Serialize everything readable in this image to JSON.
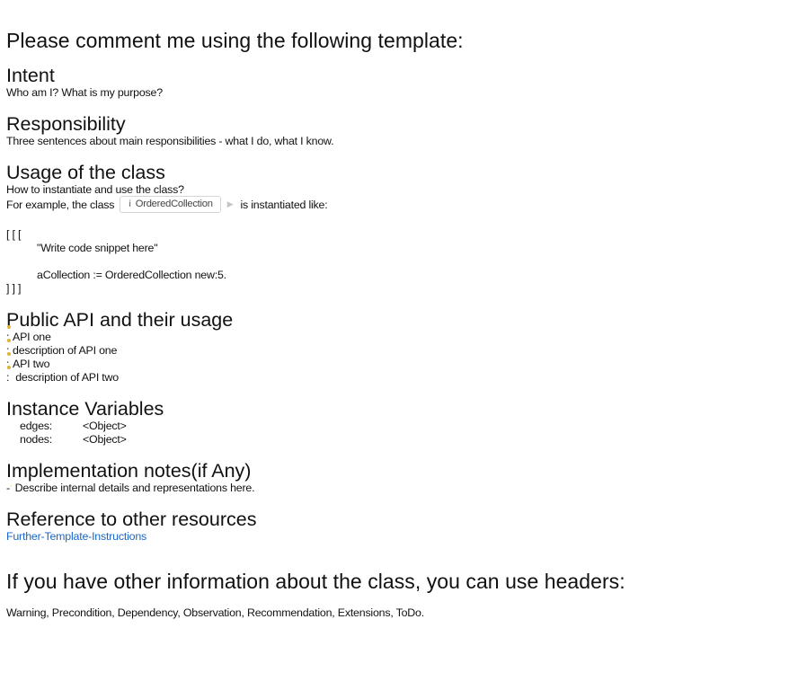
{
  "title": "Please comment me using the following template:",
  "sections": {
    "intent": {
      "heading": "Intent",
      "text": "Who am I? What is my purpose?"
    },
    "responsibility": {
      "heading": "Responsibility",
      "text": "Three sentences about main responsibilities - what I do, what I know."
    },
    "usage": {
      "heading": "Usage of the class",
      "line1": "How to instantiate and use the class?",
      "line2_prefix": "For example, the class",
      "class_chip": "OrderedCollection",
      "line2_suffix": "is instantiated like:",
      "code_open": "[ [ [",
      "code_comment": "\"Write code snippet here\"",
      "code_line": "aCollection := OrderedCollection new:5.",
      "code_close": "] ] ]"
    },
    "public_api": {
      "heading": "Public API and their usage",
      "items": [
        {
          "prefix": ";",
          "text": "API one"
        },
        {
          "prefix": ":",
          "text": "description of API one"
        },
        {
          "prefix": ";",
          "text": "API two"
        },
        {
          "prefix": ":",
          "text": " description of API two"
        }
      ]
    },
    "instance_variables": {
      "heading": "Instance Variables",
      "vars": [
        {
          "name": "edges:",
          "type": "<Object>"
        },
        {
          "name": "nodes:",
          "type": "<Object>"
        }
      ]
    },
    "implementation": {
      "heading": "Implementation notes(if Any)",
      "bullet": "-",
      "text": "Describe internal details and representations here."
    },
    "reference": {
      "heading": "Reference to other resources",
      "link": "Further-Template-Instructions"
    }
  },
  "footer": {
    "heading": "If you have other information about the class, you can use headers:",
    "text": "Warning, Precondition, Dependency, Observation, Recommendation, Extensions, ToDo."
  },
  "icons": {
    "class_chip_icon": "class-icon",
    "browse_icon": "play-icon"
  },
  "colors": {
    "link": "#1a66c4",
    "marker": "#e2b43a"
  }
}
